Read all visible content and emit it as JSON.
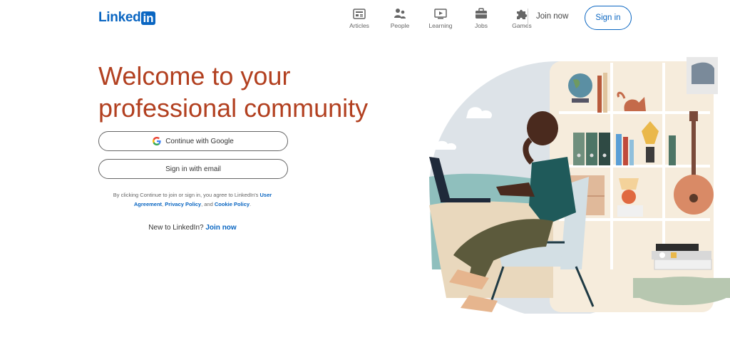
{
  "brand": {
    "logo_text": "Linked",
    "logo_box": "in",
    "primary_color": "#0a66c2",
    "headline_color": "#b24020"
  },
  "nav": {
    "items": [
      {
        "label": "Articles",
        "icon": "articles-icon"
      },
      {
        "label": "People",
        "icon": "people-icon"
      },
      {
        "label": "Learning",
        "icon": "learning-icon"
      },
      {
        "label": "Jobs",
        "icon": "jobs-icon"
      },
      {
        "label": "Games",
        "icon": "games-icon"
      }
    ],
    "join_now": "Join now",
    "sign_in": "Sign in"
  },
  "main": {
    "headline_line1": "Welcome to your",
    "headline_line2": "professional community",
    "google_button": "Continue with Google",
    "email_button": "Sign in with email",
    "legal_prefix": "By clicking Continue to join or sign in, you agree to LinkedIn's ",
    "user_agreement": "User Agreement",
    "legal_sep": ", ",
    "privacy_policy": "Privacy Policy",
    "legal_and": ", and ",
    "cookie_policy": "Cookie Policy",
    "legal_end": ".",
    "new_to": "New to LinkedIn? ",
    "join_now_link": "Join now"
  }
}
